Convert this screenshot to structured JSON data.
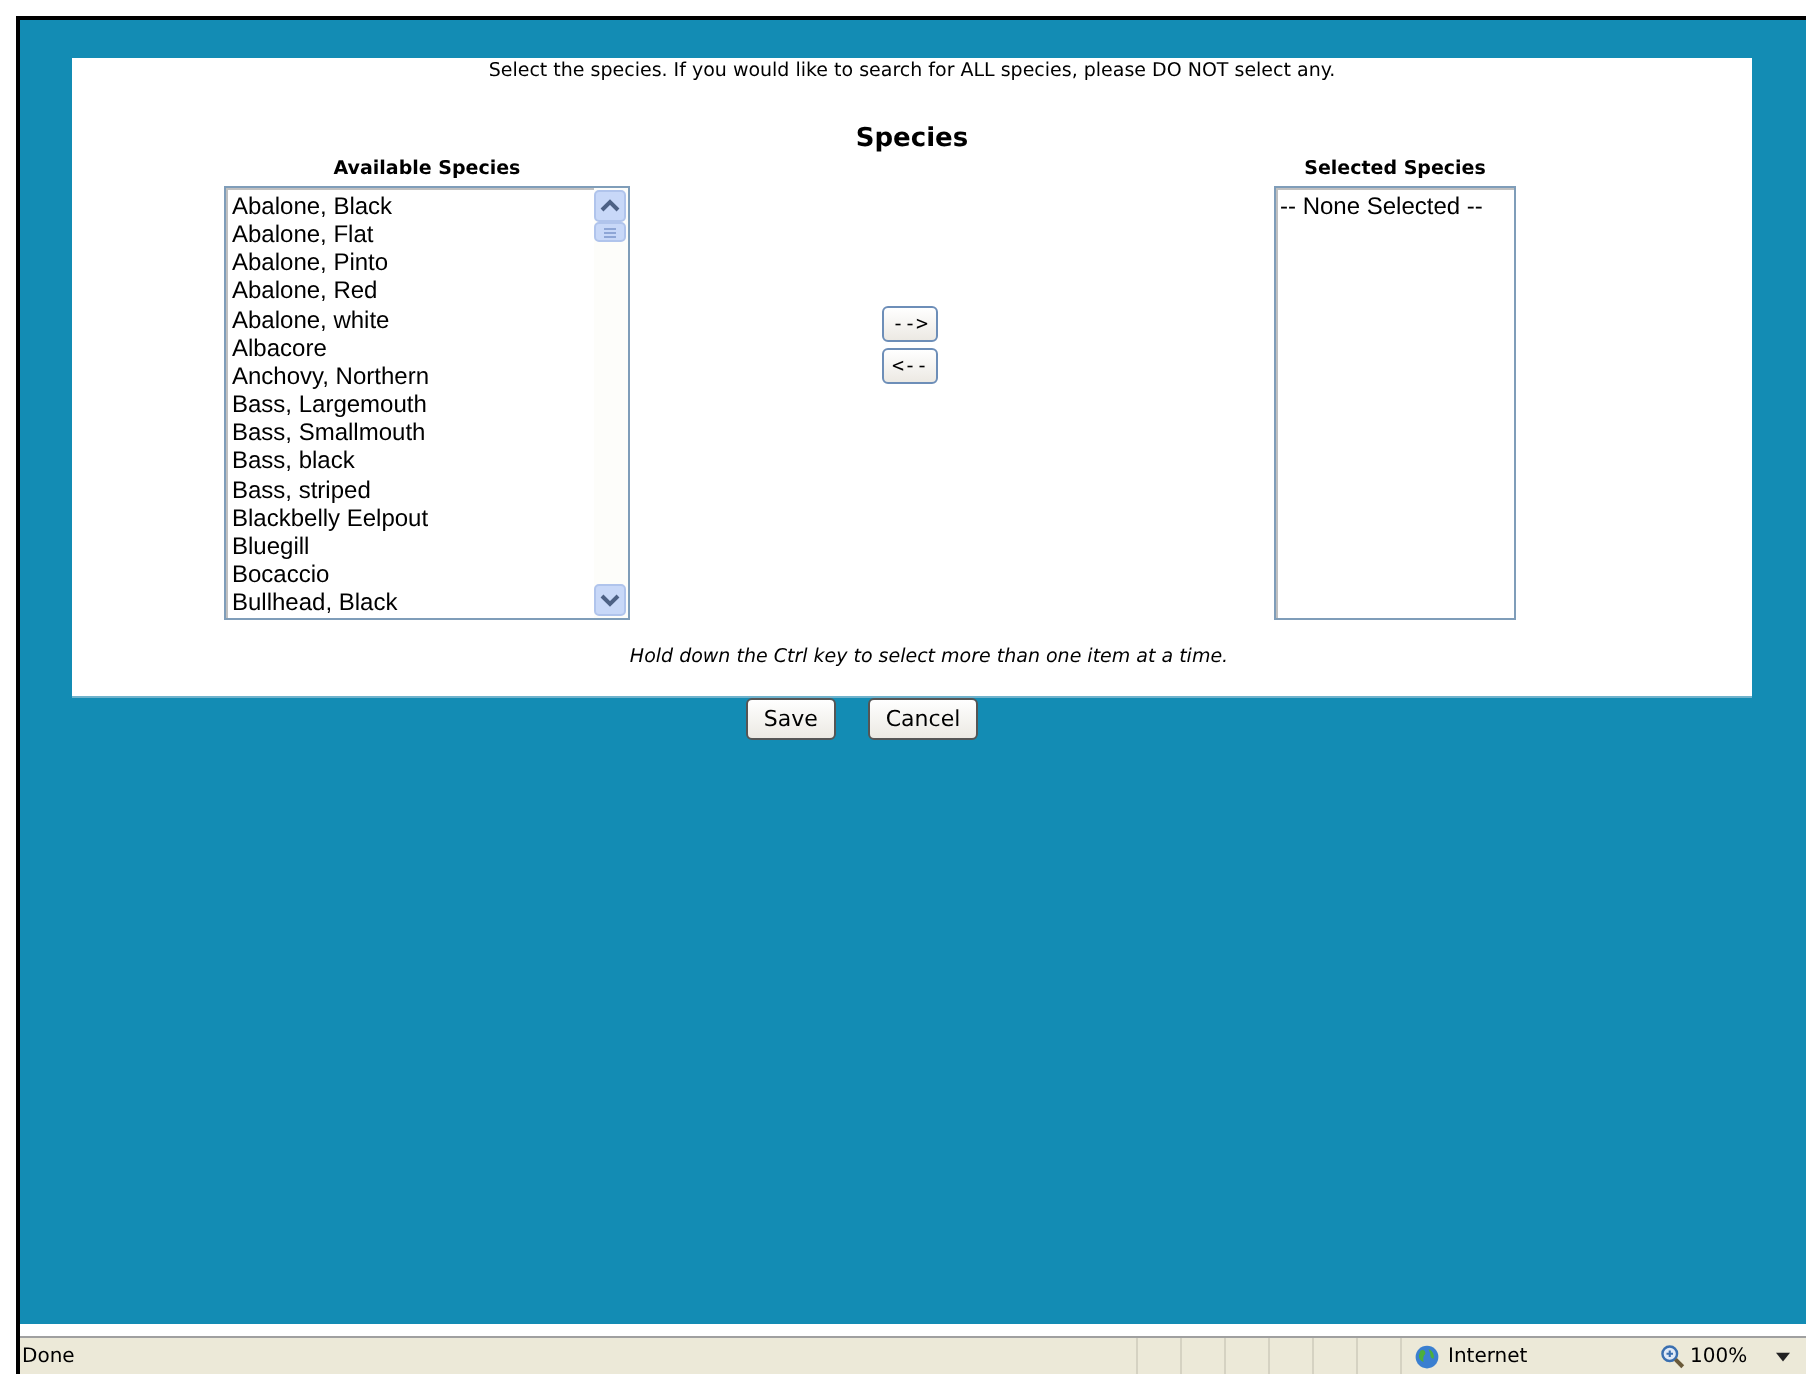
{
  "instruction": "Select the species. If you would like to search for ALL species, please DO NOT select any.",
  "heading": "Species",
  "available": {
    "label": "Available Species",
    "items": [
      {
        "text": "Abalone, Black",
        "selected": false
      },
      {
        "text": "Abalone, Flat",
        "selected": false
      },
      {
        "text": "Abalone, Pinto",
        "selected": false
      },
      {
        "text": "Abalone, Red",
        "selected": false
      },
      {
        "text": "Abalone, white",
        "selected": false
      },
      {
        "text": "Albacore",
        "selected": false
      },
      {
        "text": "Anchovy, Northern",
        "selected": false
      },
      {
        "text": "Bass, Largemouth",
        "selected": false
      },
      {
        "text": "Bass, Smallmouth",
        "selected": false
      },
      {
        "text": "Bass, black",
        "selected": false
      },
      {
        "text": "Bass, striped",
        "selected": false
      },
      {
        "text": "Blackbelly Eelpout",
        "selected": false
      },
      {
        "text": "Bluegill",
        "selected": false
      },
      {
        "text": "Bocaccio",
        "selected": false
      },
      {
        "text": "Bullhead, Black",
        "selected": false
      }
    ]
  },
  "move_buttons": [
    "-->",
    "<--"
  ],
  "selected": {
    "label": "Selected Species",
    "items": [
      {
        "text": "-- None Selected --",
        "selected": false
      }
    ]
  },
  "note": "Hold down the Ctrl key to select more than one item at a time.",
  "buttons": [
    "Save",
    "Cancel"
  ],
  "status_bar": {
    "text": "Done",
    "zone": "Internet",
    "zoom": "100%"
  }
}
